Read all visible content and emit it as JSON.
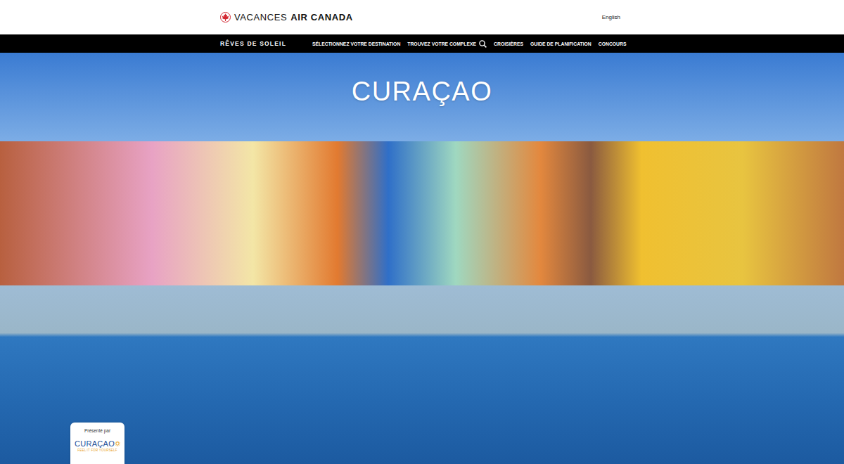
{
  "header": {
    "brand_light": "VACANCES",
    "brand_bold": "AIR CANADA",
    "language": "English"
  },
  "nav": {
    "title": "RÊVES DE SOLEIL",
    "items": [
      {
        "label": "SÉLECTIONNEZ VOTRE DESTINATION",
        "kind": "link"
      },
      {
        "label": "TROUVEZ VOTRE COMPLEXE",
        "kind": "search"
      },
      {
        "label": "CROISIÈRES",
        "kind": "link"
      },
      {
        "label": "GUIDE DE PLANIFICATION",
        "kind": "link"
      },
      {
        "label": "CONCOURS",
        "kind": "link"
      }
    ]
  },
  "hero": {
    "title": "CURAÇAO"
  },
  "sponsor": {
    "label": "Présenté par",
    "logo": "CURAÇAO",
    "tagline": "FEEL IT FOR YOURSELF"
  }
}
